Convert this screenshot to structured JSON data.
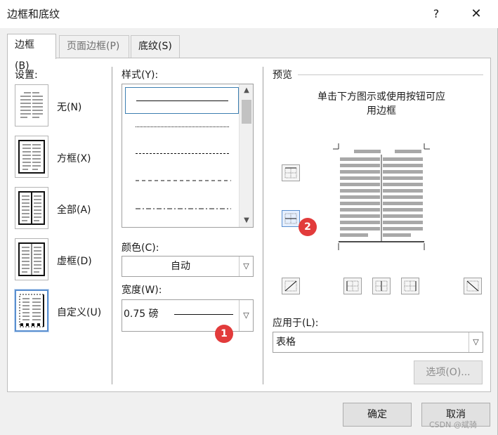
{
  "window": {
    "title": "边框和底纹",
    "help_label": "?",
    "close_label": "✕"
  },
  "tabs": [
    {
      "label": "边框(B)"
    },
    {
      "label": "页面边框(P)"
    },
    {
      "label": "底纹(S)"
    }
  ],
  "settings": {
    "heading": "设置:",
    "items": [
      {
        "label": "无(N)"
      },
      {
        "label": "方框(X)"
      },
      {
        "label": "全部(A)"
      },
      {
        "label": "虚框(D)"
      },
      {
        "label": "自定义(U)"
      }
    ],
    "selected_index": 4
  },
  "style": {
    "heading": "样式(Y):",
    "options": [
      "solid",
      "dotted",
      "dash-small",
      "dashed",
      "dash-dot"
    ],
    "selected_index": 0
  },
  "color": {
    "label": "颜色(C):",
    "value": "自动"
  },
  "width": {
    "label": "宽度(W):",
    "value": "0.75 磅"
  },
  "preview": {
    "heading": "预览",
    "instruction_line1": "单击下方图示或使用按钮可应",
    "instruction_line2": "用边框"
  },
  "apply_to": {
    "label": "应用于(L):",
    "value": "表格"
  },
  "buttons": {
    "options": "选项(O)...",
    "ok": "确定",
    "cancel": "取消"
  },
  "annotations": {
    "badge1": "1",
    "badge2": "2"
  },
  "watermark": "CSDN @斌骑",
  "colors": {
    "accent": "#5a8fd0",
    "badge": "#e23b3b",
    "panel_bg": "#ffffff",
    "dialog_bg": "#f0f0f0"
  }
}
